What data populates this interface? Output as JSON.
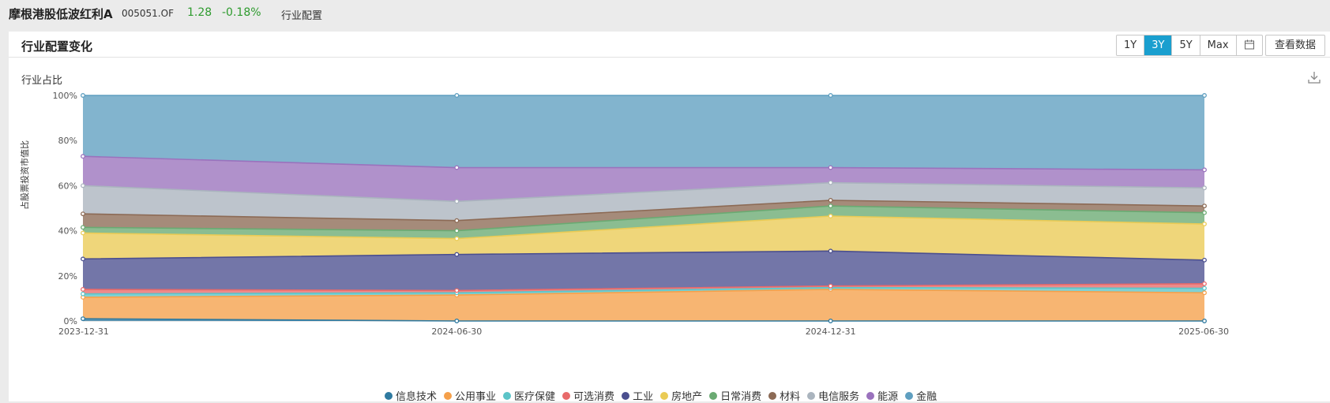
{
  "header": {
    "fund_name": "摩根港股低波红利A",
    "fund_code": "005051.OF",
    "price": "1.28",
    "change": "-0.18%",
    "tab": "行业配置"
  },
  "panel": {
    "title": "行业配置变化",
    "range_buttons": [
      "1Y",
      "3Y",
      "5Y",
      "Max"
    ],
    "active_range": "3Y",
    "calendar_icon": "calendar-icon",
    "view_data_label": "查看数据",
    "download_icon": "download-icon"
  },
  "chart_data": {
    "type": "area",
    "stacked": true,
    "title": "行业占比",
    "ylabel": "占股票投资市值比",
    "x": [
      "2023-12-31",
      "2024-06-30",
      "2024-12-31",
      "2025-06-30"
    ],
    "ylim": [
      0,
      100
    ],
    "yticks": [
      "0%",
      "20%",
      "40%",
      "60%",
      "80%",
      "100%"
    ],
    "legend_position": "bottom",
    "series": [
      {
        "name": "信息技术",
        "color": "#2f7aa0",
        "values": [
          1.0,
          0.0,
          0.0,
          0.0
        ]
      },
      {
        "name": "公用事业",
        "color": "#f5a04a",
        "values": [
          9.5,
          11.5,
          14.0,
          12.5
        ]
      },
      {
        "name": "医疗保健",
        "color": "#5cc4c8",
        "values": [
          1.5,
          1.0,
          0.8,
          2.0
        ]
      },
      {
        "name": "可选消费",
        "color": "#e86a6a",
        "values": [
          2.0,
          1.0,
          0.7,
          2.0
        ]
      },
      {
        "name": "工业",
        "color": "#4b4f8f",
        "values": [
          13.5,
          16.0,
          15.5,
          10.5
        ]
      },
      {
        "name": "房地产",
        "color": "#eacb55",
        "values": [
          11.5,
          7.0,
          15.5,
          16.0
        ]
      },
      {
        "name": "日常消费",
        "color": "#6aaa72",
        "values": [
          2.5,
          3.5,
          4.5,
          5.0
        ]
      },
      {
        "name": "材料",
        "color": "#8c6a55",
        "values": [
          6.0,
          4.5,
          2.5,
          3.0
        ]
      },
      {
        "name": "电信服务",
        "color": "#aab4be",
        "values": [
          12.5,
          8.5,
          7.8,
          8.0
        ]
      },
      {
        "name": "能源",
        "color": "#9a72bd",
        "values": [
          13.0,
          15.0,
          6.7,
          8.0
        ]
      },
      {
        "name": "金融",
        "color": "#5f9fc0",
        "values": [
          27.0,
          32.0,
          32.0,
          33.0
        ]
      }
    ]
  }
}
